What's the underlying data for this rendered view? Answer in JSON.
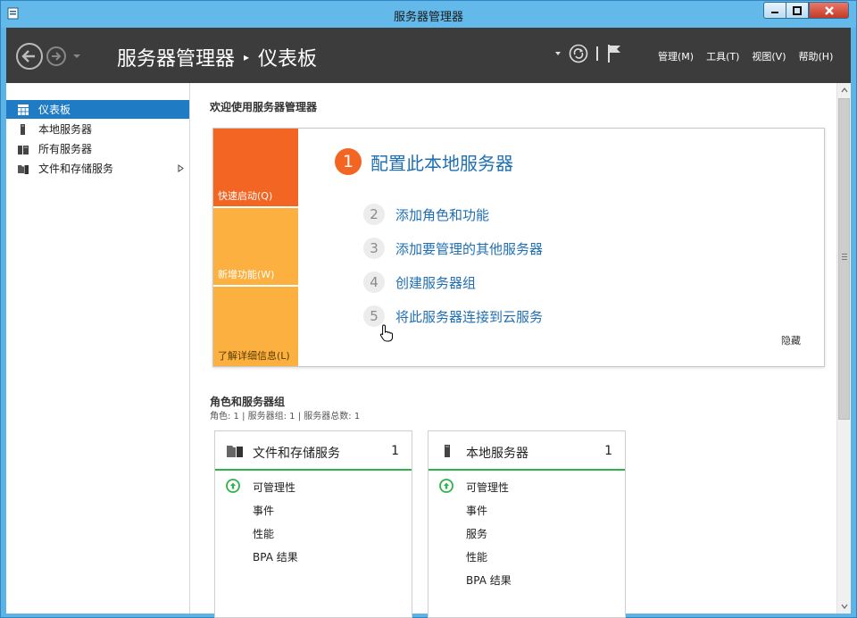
{
  "window": {
    "title": "服务器管理器",
    "controls": {
      "minimize": "minimize-icon",
      "maximize": "maximize-icon",
      "close": "close-icon"
    }
  },
  "header": {
    "breadcrumb_root": "服务器管理器",
    "breadcrumb_separator": "▸",
    "breadcrumb_current": "仪表板",
    "menus": [
      "管理(M)",
      "工具(T)",
      "视图(V)",
      "帮助(H)"
    ]
  },
  "sidebar": {
    "items": [
      {
        "label": "仪表板",
        "icon": "dashboard-icon",
        "active": true
      },
      {
        "label": "本地服务器",
        "icon": "server-icon"
      },
      {
        "label": "所有服务器",
        "icon": "servers-icon"
      },
      {
        "label": "文件和存储服务",
        "icon": "file-storage-icon",
        "has_children": true
      }
    ]
  },
  "main": {
    "welcome": "欢迎使用服务器管理器",
    "quick_start": {
      "tabs": [
        "快速启动(Q)",
        "新增功能(W)",
        "了解详细信息(L)"
      ],
      "steps": [
        {
          "num": "1",
          "label": "配置此本地服务器"
        },
        {
          "num": "2",
          "label": "添加角色和功能"
        },
        {
          "num": "3",
          "label": "添加要管理的其他服务器"
        },
        {
          "num": "4",
          "label": "创建服务器组"
        },
        {
          "num": "5",
          "label": "将此服务器连接到云服务"
        }
      ],
      "hide": "隐藏"
    },
    "roles": {
      "title": "角色和服务器组",
      "subtitle": "角色: 1 | 服务器组: 1 | 服务器总数: 1",
      "cards": [
        {
          "name": "文件和存储服务",
          "count": "1",
          "rows": [
            "可管理性",
            "事件",
            "性能",
            "BPA 结果"
          ]
        },
        {
          "name": "本地服务器",
          "count": "1",
          "rows": [
            "可管理性",
            "事件",
            "服务",
            "性能",
            "BPA 结果"
          ]
        }
      ]
    }
  },
  "colors": {
    "accent": "#1f7bc4",
    "quick_start_orange": "#f26522",
    "tab_yellow": "#fbb040",
    "status_green": "#2db34a"
  }
}
